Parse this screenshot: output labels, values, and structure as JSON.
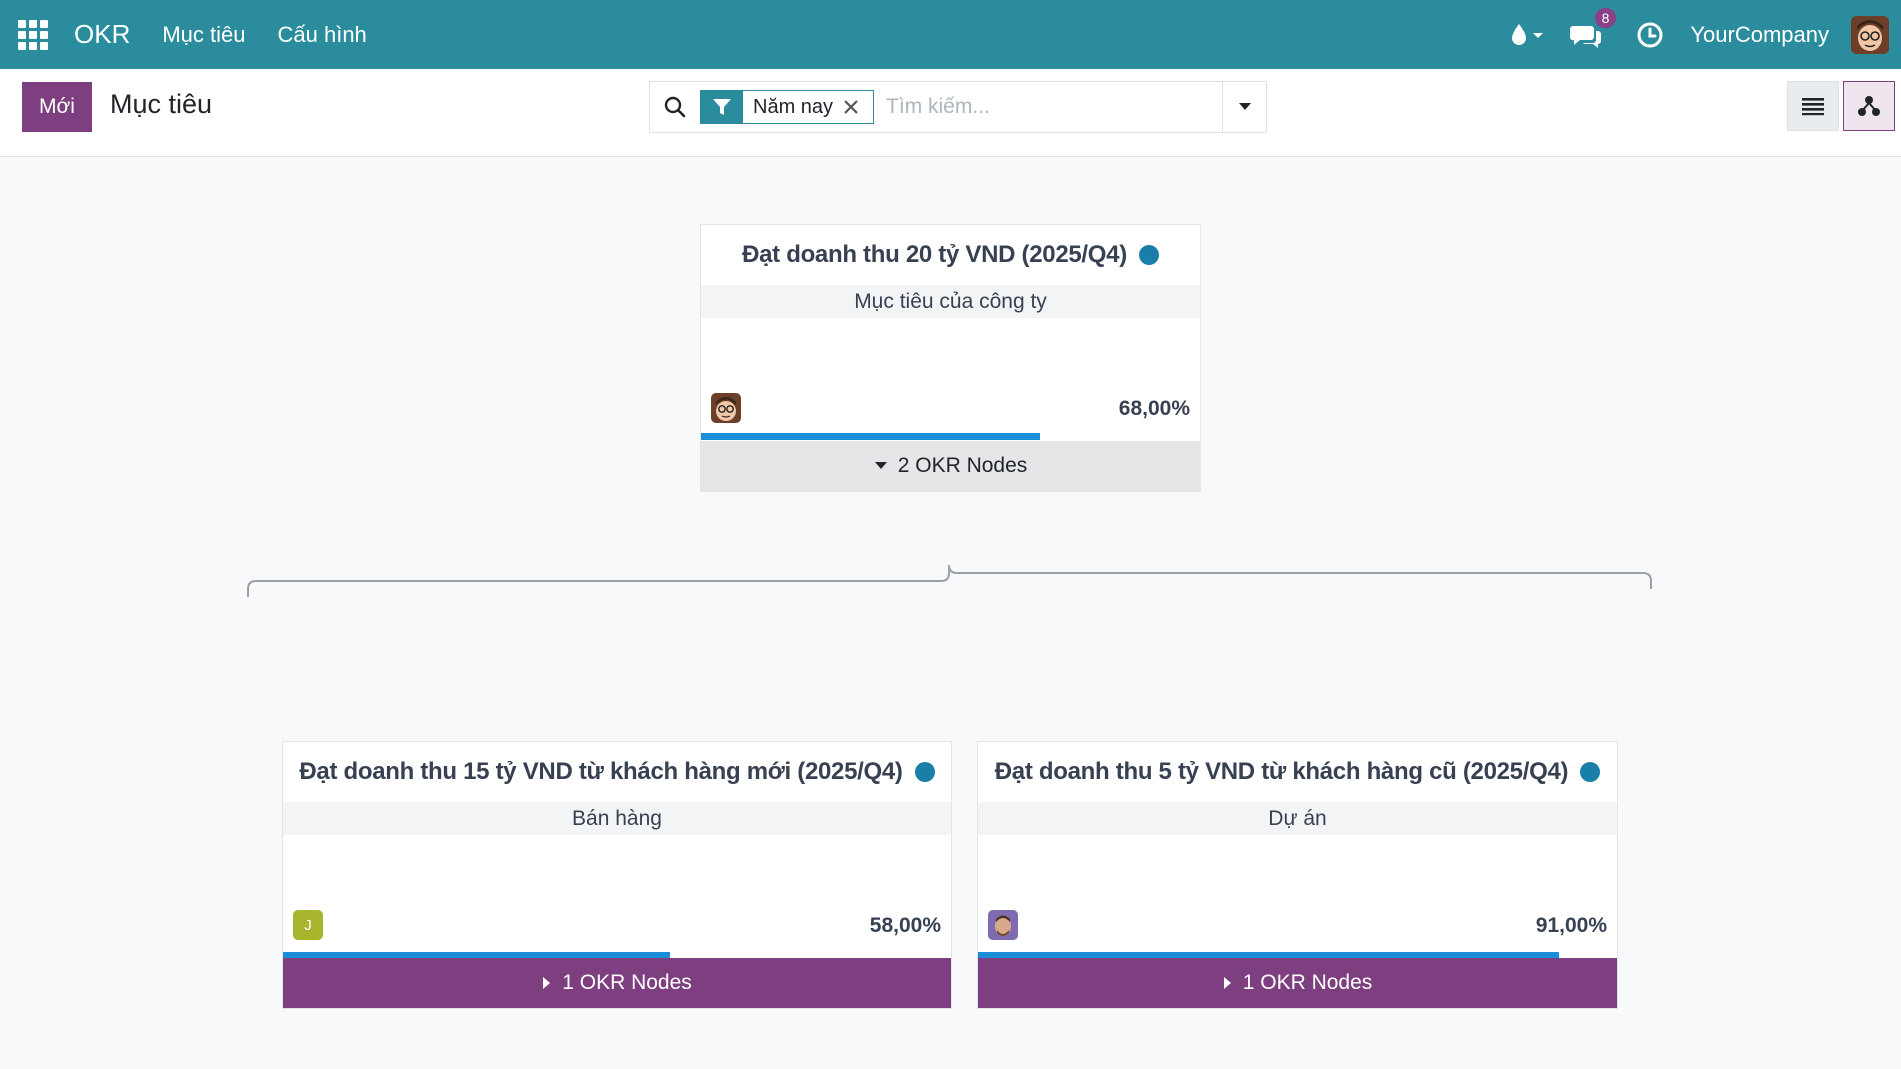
{
  "navbar": {
    "brand": "OKR",
    "menu": [
      "Mục tiêu",
      "Cấu hình"
    ],
    "message_count": "8",
    "company": "YourCompany"
  },
  "control": {
    "new_label": "Mới",
    "title": "Mục tiêu",
    "facet_label": "Năm nay",
    "search_placeholder": "Tìm kiếm..."
  },
  "nodes": {
    "root": {
      "title": "Đạt doanh thu 20 tỷ VND (2025/Q4)",
      "team": "Mục tiêu của công ty",
      "progress_label": "68,00%",
      "progress": 0.68,
      "children_label": "2 OKR Nodes",
      "status_color": "#1a7fa8"
    },
    "child1": {
      "title": "Đạt doanh thu 15 tỷ VND từ khách hàng mới (2025/Q4)",
      "team": "Bán hàng",
      "owner_initial": "J",
      "progress_label": "58,00%",
      "progress": 0.58,
      "children_label": "1 OKR Nodes",
      "status_color": "#1a7fa8"
    },
    "child2": {
      "title": "Đạt doanh thu 5 tỷ VND từ khách hàng cũ (2025/Q4)",
      "team": "Dự án",
      "progress_label": "91,00%",
      "progress": 0.91,
      "children_label": "1 OKR Nodes",
      "status_color": "#1a7fa8"
    }
  },
  "colors": {
    "navbar": "#2a8c9c",
    "primary": "#7d3f7f",
    "progress": "#1a8fd8"
  }
}
